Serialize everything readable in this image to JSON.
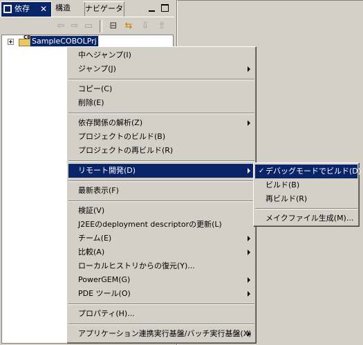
{
  "tabs": {
    "active_label": "依存",
    "structure_label": "構造",
    "navigator_label": "ナビゲータ"
  },
  "toolbar": {
    "icons": [
      "back-arrow-icon",
      "forward-arrow-icon",
      "up-folder-icon",
      "collapse-all-icon",
      "link-with-editor-icon",
      "import-icon",
      "export-icon"
    ]
  },
  "tree": {
    "project_label": "SampleCOBOLPrj",
    "project_badge": "CB"
  },
  "context_menu": {
    "items": [
      {
        "label": "中へジャンプ(I)"
      },
      {
        "label": "ジャンプ(J)"
      },
      {
        "label": "コピー(C)"
      },
      {
        "label": "削除(E)"
      },
      {
        "label": "依存関係の解析(Z)"
      },
      {
        "label": "プロジェクトのビルド(B)"
      },
      {
        "label": "プロジェクトの再ビルド(R)"
      },
      {
        "label": "リモート開発(D)"
      },
      {
        "label": "最新表示(F)"
      },
      {
        "label": "検証(V)"
      },
      {
        "label": "J2EEのdeployment descriptorの更新(L)"
      },
      {
        "label": "チーム(E)"
      },
      {
        "label": "比較(A)"
      },
      {
        "label": "ローカルヒストリからの復元(Y)..."
      },
      {
        "label": "PowerGEM(G)"
      },
      {
        "label": "PDE ツール(O)"
      },
      {
        "label": "プロパティ(H)..."
      },
      {
        "label": "アプリケーション連携実行基盤/バッチ実行基盤(X)"
      }
    ]
  },
  "submenu": {
    "items": [
      {
        "label": "デバッグモードでビルド(D)",
        "checked": true
      },
      {
        "label": "ビルド(B)"
      },
      {
        "label": "再ビルド(R)"
      },
      {
        "label": "メイクファイル生成(M)..."
      }
    ],
    "check_mark": "✓"
  },
  "colors": {
    "selection": "#0a246a",
    "face": "#d4d0c8"
  }
}
